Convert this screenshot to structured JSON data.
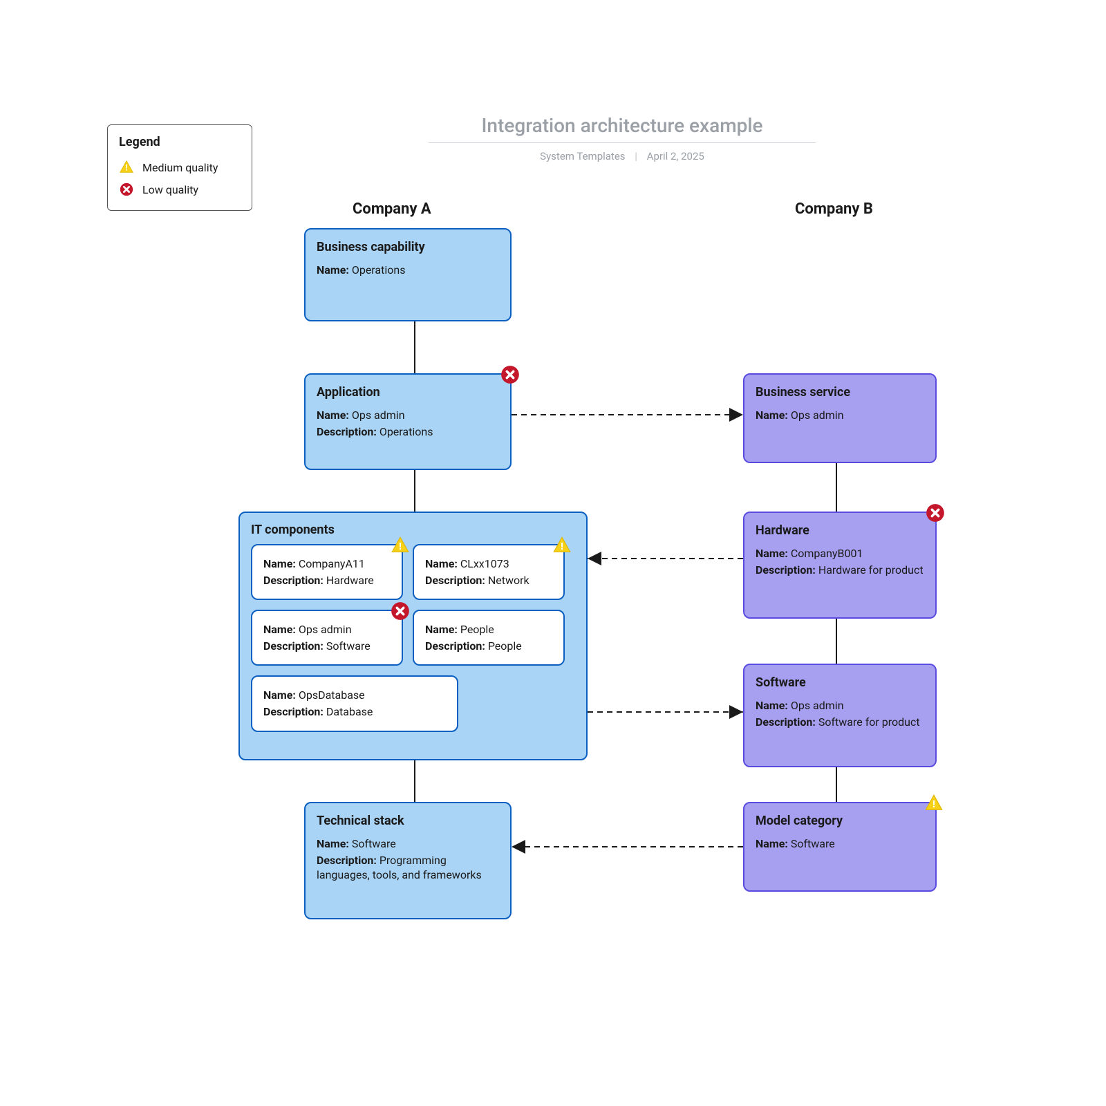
{
  "title": {
    "main": "Integration architecture example",
    "author": "System Templates",
    "date": "April 2, 2025"
  },
  "legend": {
    "heading": "Legend",
    "medium": "Medium quality",
    "low": "Low quality"
  },
  "columns": {
    "a": "Company A",
    "b": "Company B"
  },
  "companyA": {
    "businessCapability": {
      "heading": "Business capability",
      "name_label": "Name:",
      "name": "Operations"
    },
    "application": {
      "heading": "Application",
      "name_label": "Name:",
      "name": "Ops admin",
      "desc_label": "Description:",
      "desc": "Operations"
    },
    "itComponents": {
      "heading": "IT components",
      "items": [
        {
          "name_label": "Name:",
          "name": "CompanyA11",
          "desc_label": "Description:",
          "desc": "Hardware",
          "quality": "medium"
        },
        {
          "name_label": "Name:",
          "name": "CLxx1073",
          "desc_label": "Description:",
          "desc": "Network",
          "quality": "medium"
        },
        {
          "name_label": "Name:",
          "name": "Ops admin",
          "desc_label": "Description:",
          "desc": "Software",
          "quality": "low"
        },
        {
          "name_label": "Name:",
          "name": "People",
          "desc_label": "Description:",
          "desc": "People",
          "quality": null
        },
        {
          "name_label": "Name:",
          "name": "OpsDatabase",
          "desc_label": "Description:",
          "desc": "Database",
          "quality": null
        }
      ]
    },
    "technicalStack": {
      "heading": "Technical stack",
      "name_label": "Name:",
      "name": "Software",
      "desc_label": "Description:",
      "desc": "Programming languages, tools, and frameworks"
    }
  },
  "companyB": {
    "businessService": {
      "heading": "Business service",
      "name_label": "Name:",
      "name": "Ops admin"
    },
    "hardware": {
      "heading": "Hardware",
      "name_label": "Name:",
      "name": "CompanyB001",
      "desc_label": "Description:",
      "desc": "Hardware for product",
      "quality": "low"
    },
    "software": {
      "heading": "Software",
      "name_label": "Name:",
      "name": "Ops admin",
      "desc_label": "Description:",
      "desc": "Software for product"
    },
    "modelCategory": {
      "heading": "Model category",
      "name_label": "Name:",
      "name": "Software",
      "quality": "medium"
    }
  }
}
